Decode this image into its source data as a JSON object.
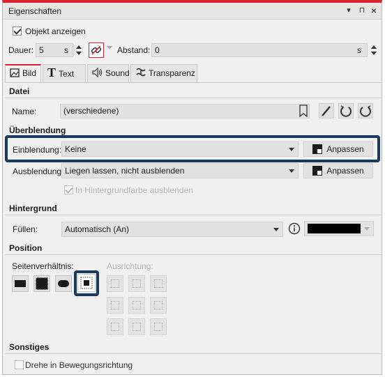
{
  "window": {
    "title": "Eigenschaften",
    "controls": {
      "dropdown": "▾",
      "pin": "⊓",
      "close": "×"
    }
  },
  "top": {
    "show_object_label": "Objekt anzeigen",
    "show_object_checked": true,
    "duration_label": "Dauer:",
    "duration_value": "5",
    "duration_unit": "s",
    "distance_label": "Abstand:",
    "distance_value": "0",
    "distance_unit": "s"
  },
  "tabs": [
    {
      "label": "Bild",
      "icon": "image-icon",
      "active": true
    },
    {
      "label": "Text",
      "icon": "text-icon",
      "active": false
    },
    {
      "label": "Sound",
      "icon": "speaker-icon",
      "active": false
    },
    {
      "label": "Transparenz",
      "icon": "transparency-icon",
      "active": false
    }
  ],
  "datei": {
    "header": "Datei",
    "name_label": "Name:",
    "name_value": "(verschiedene)"
  },
  "ueberblendung": {
    "header": "Überblendung",
    "einblendung_label": "Einblendung:",
    "einblendung_value": "Keine",
    "ausblendung_label": "Ausblendung:",
    "ausblendung_value": "Liegen lassen, nicht ausblenden",
    "adjust_label": "Anpassen",
    "background_fade_label": "In Hintergrundfarbe ausblenden",
    "background_fade_checked": true
  },
  "hintergrund": {
    "header": "Hintergrund",
    "fill_label": "Füllen:",
    "fill_value": "Automatisch (An)",
    "color": "#000000"
  },
  "position": {
    "header": "Position",
    "aspect_label": "Seitenverhältnis:",
    "alignment_label": "Ausrichtung:"
  },
  "sonstiges": {
    "header": "Sonstiges",
    "rotate_label": "Drehe in Bewegungsrichtung",
    "rotate_checked": false
  },
  "colors": {
    "accent_red": "#d9252b",
    "highlight_border": "#1a3a5c"
  }
}
